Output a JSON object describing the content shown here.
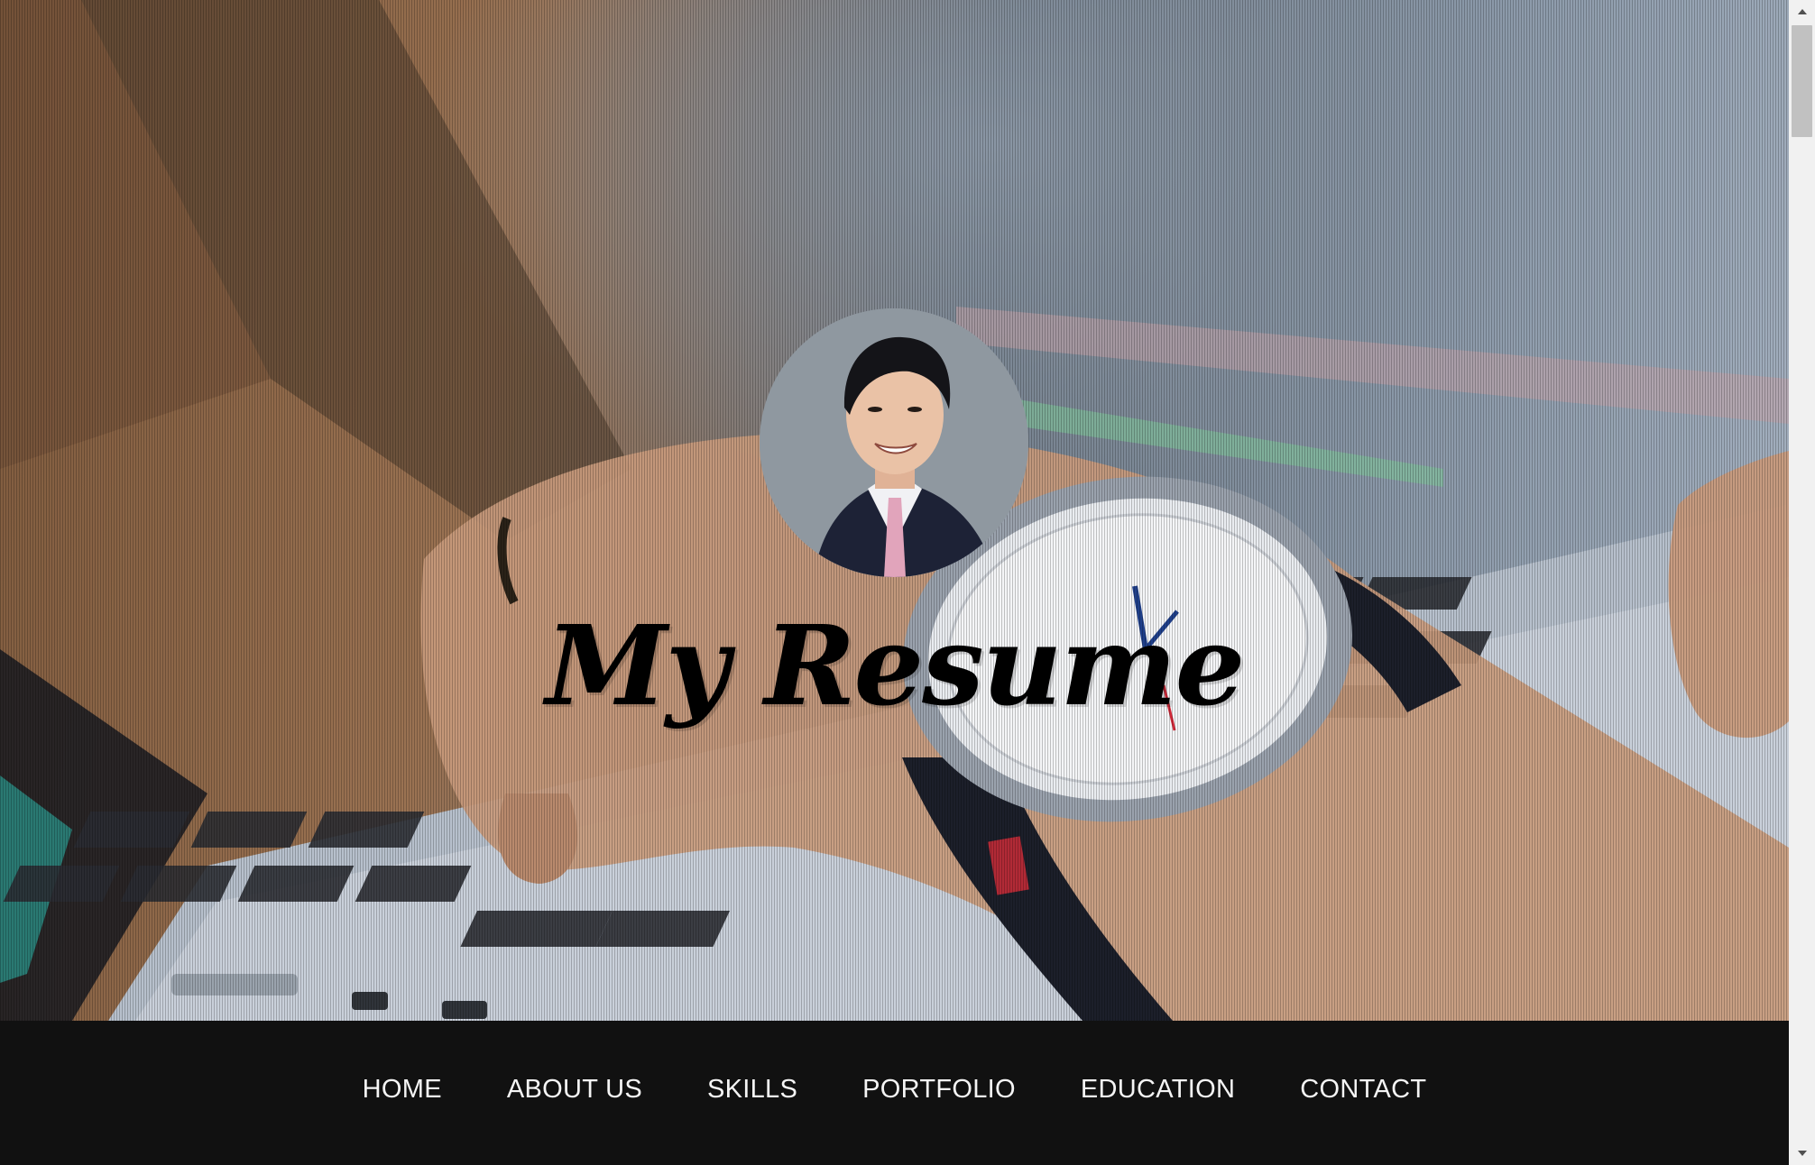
{
  "hero": {
    "title": "My Resume",
    "avatar_icon": "profile-photo",
    "background_icon": "laptop-wristwatch-photo"
  },
  "nav": {
    "items": [
      {
        "label": "HOME"
      },
      {
        "label": "ABOUT US"
      },
      {
        "label": "SKILLS"
      },
      {
        "label": "PORTFOLIO"
      },
      {
        "label": "EDUCATION"
      },
      {
        "label": "CONTACT"
      }
    ]
  },
  "colors": {
    "nav_background": "#111111",
    "nav_text": "#f5f5f5",
    "title_text": "#000000"
  }
}
